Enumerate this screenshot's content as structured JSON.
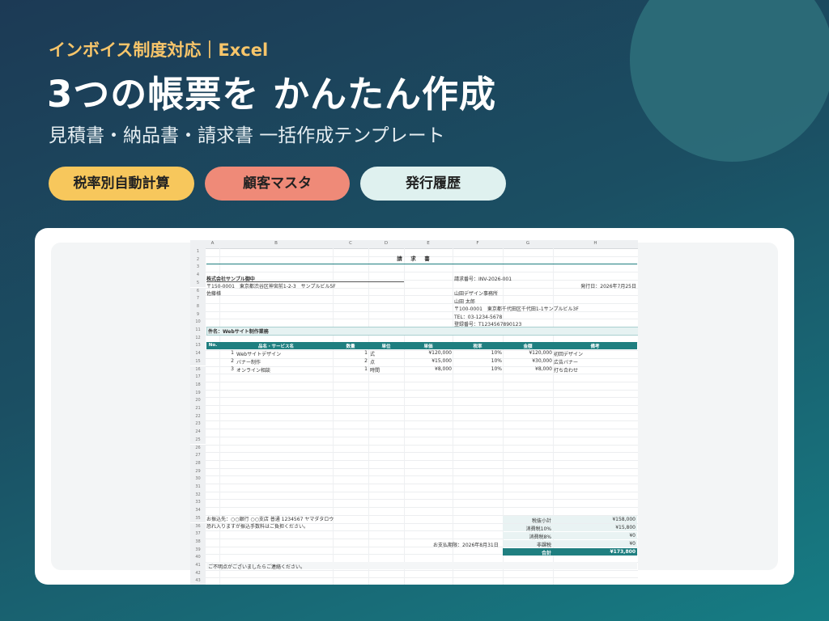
{
  "hero": {
    "eyebrow": "インボイス制度対応｜Excel",
    "headline": "3つの帳票を かんたん作成",
    "subline": "見積書・納品書・請求書 一括作成テンプレート",
    "features": [
      "税率別自動計算",
      "顧客マスタ",
      "発行履歴"
    ]
  },
  "colors": {
    "accent": "#1f7f80",
    "pill_yellow": "#f7c75c",
    "pill_coral": "#ef8a78",
    "pill_mint": "#dff1ef"
  },
  "sheet": {
    "columns": [
      "A",
      "B",
      "C",
      "D",
      "E",
      "F",
      "G",
      "H"
    ],
    "row_numbers": [
      "1",
      "2",
      "3",
      "4",
      "5",
      "6",
      "7",
      "8",
      "9",
      "10",
      "11",
      "12",
      "13",
      "14",
      "15",
      "16",
      "17",
      "18",
      "19",
      "20",
      "21",
      "22",
      "23",
      "24",
      "25",
      "26",
      "27",
      "28",
      "29",
      "30",
      "31",
      "32",
      "33",
      "34",
      "35",
      "36",
      "37",
      "38",
      "39",
      "40",
      "41",
      "42",
      "43"
    ],
    "doc_title": "請　求　書",
    "client": {
      "name": "株式会社サンプル御中",
      "address": "〒150-0001　東京都渋谷区神宮前1-2-3　サンプルビル5F",
      "attn": "佐藤様"
    },
    "invoice_no": "請求番号：INV-2026-001",
    "issue_date": "発行日：2026年7月25日",
    "issuer": {
      "company": "山田デザイン事務所",
      "person": "山田 太郎",
      "address": "〒100-0001　東京都千代田区千代田1-1サンプルビル3F",
      "tel": "TEL：03-1234-5678",
      "reg_no": "登録番号：T1234567890123"
    },
    "subject": "件名：Webサイト制作業務",
    "table_headers": [
      "No.",
      "品名・サービス名",
      "数量",
      "単位",
      "単価",
      "税率",
      "金額",
      "備考"
    ],
    "items": [
      {
        "no": "1",
        "name": "Webサイトデザイン",
        "qty": "1",
        "unit": "式",
        "price": "¥120,000",
        "tax": "10%",
        "amount": "¥120,000",
        "note": "初回デザイン"
      },
      {
        "no": "2",
        "name": "バナー制作",
        "qty": "2",
        "unit": "点",
        "price": "¥15,000",
        "tax": "10%",
        "amount": "¥30,000",
        "note": "広告バナー"
      },
      {
        "no": "3",
        "name": "オンライン相談",
        "qty": "1",
        "unit": "時間",
        "price": "¥8,000",
        "tax": "10%",
        "amount": "¥8,000",
        "note": "打ち合わせ"
      }
    ],
    "bank": "お振込先：○○銀行 ○○支店 普通 1234567 ヤマダタロウ",
    "fee_note": "恐れ入りますが振込手数料はご負担ください。",
    "due": "お支払期限：2026年8月31日",
    "totals": [
      {
        "label": "税抜小計",
        "value": "¥158,000"
      },
      {
        "label": "消費税10%",
        "value": "¥15,800"
      },
      {
        "label": "消費税8%",
        "value": "¥0"
      },
      {
        "label": "非課税",
        "value": "¥0"
      },
      {
        "label": "合計",
        "value": "¥173,800"
      }
    ],
    "footer_note": "ご不明点がございましたらご連絡ください。"
  }
}
